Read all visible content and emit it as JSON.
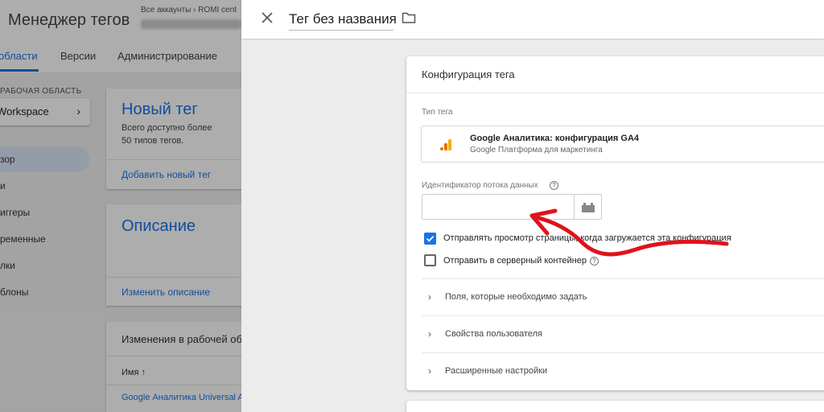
{
  "background_app": {
    "app_title": "Менеджер тегов",
    "account_breadcrumb": "Все аккаунты › ROMI cent",
    "nav_tabs": [
      "области",
      "Версии",
      "Администрирование"
    ],
    "workspace_label": "РАБОЧАЯ ОБЛАСТЬ",
    "workspace_name": "Workspace",
    "sidebar_items": [
      "зор",
      "и",
      "иггеры",
      "ременные",
      "лки",
      "блоны"
    ],
    "new_tag_card": {
      "title": "Новый тег",
      "text_line1": "Всего доступно более",
      "text_line2": "50 типов тегов.",
      "link": "Добавить новый тег"
    },
    "description_card": {
      "title": "Описание",
      "link": "Изменить описание"
    },
    "changes_card": {
      "title": "Изменения в рабочей об",
      "column_header": "Имя ↑",
      "row_link": "Google Аналитика Universal A"
    }
  },
  "editor": {
    "tag_name": "Тег без названия",
    "config_card": {
      "title": "Конфигурация тега",
      "tag_type_label": "Тип тега",
      "tag_type_name": "Google Аналитика: конфигурация GA4",
      "tag_type_provider": "Google Платформа для маркетинга",
      "stream_id_label": "Идентификатор потока данных",
      "stream_id_value": "",
      "checkbox_pageview": {
        "label": "Отправлять просмотр страницы, когда загружается эта конфигурация",
        "checked": true
      },
      "checkbox_server": {
        "label": "Отправить в серверный контейнер",
        "checked": false
      },
      "sections": [
        "Поля, которые необходимо задать",
        "Свойства пользователя",
        "Расширенные настройки"
      ]
    }
  },
  "colors": {
    "accent": "#1a73e8",
    "annotation_arrow": "#e0121b",
    "ga_orange": "#f9ab00",
    "ga_dark_orange": "#e37400"
  },
  "icons": {
    "close": "close-icon",
    "folder": "folder-icon",
    "help": "help-icon",
    "variable": "variable-icon",
    "ga": "google-analytics-icon",
    "chevron": "chevron-right-icon"
  }
}
